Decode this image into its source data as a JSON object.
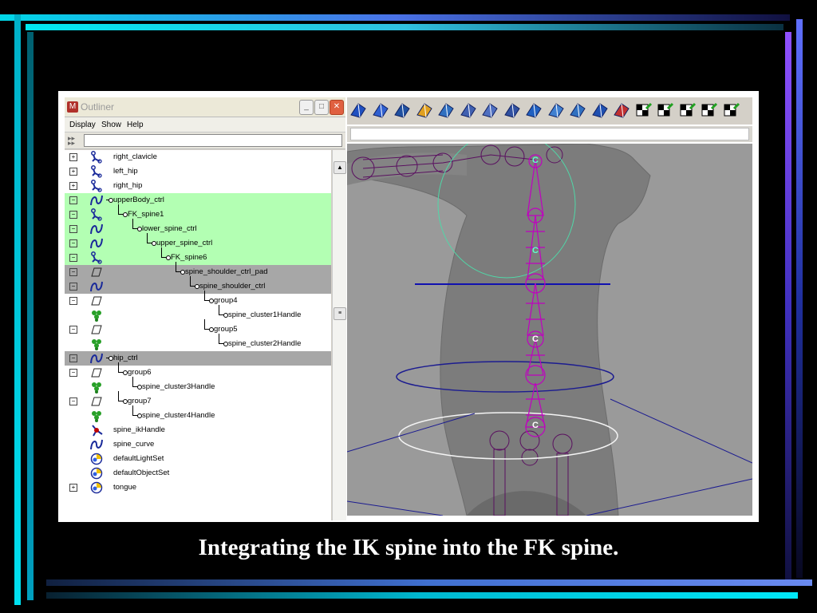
{
  "outliner": {
    "title": "Outliner",
    "menu": [
      "Display",
      "Show",
      "Help"
    ],
    "filter_value": "",
    "items": [
      {
        "label": "right_clavicle",
        "expander": "+",
        "icon": "joint-icon",
        "highlight": ""
      },
      {
        "label": "left_hip",
        "expander": "+",
        "icon": "joint-icon",
        "highlight": ""
      },
      {
        "label": "right_hip",
        "expander": "+",
        "icon": "joint-icon",
        "highlight": ""
      },
      {
        "label": "upperBody_ctrl",
        "expander": "−",
        "icon": "curve-icon",
        "highlight": "green"
      },
      {
        "label": "FK_spine1",
        "expander": "−",
        "icon": "joint-icon",
        "highlight": "green"
      },
      {
        "label": "lower_spine_ctrl",
        "expander": "−",
        "icon": "curve-icon",
        "highlight": "green"
      },
      {
        "label": "upper_spine_ctrl",
        "expander": "−",
        "icon": "curve-icon",
        "highlight": "green"
      },
      {
        "label": "FK_spine6",
        "expander": "−",
        "icon": "joint-icon",
        "highlight": "green"
      },
      {
        "label": "spine_shoulder_ctrl_pad",
        "expander": "−",
        "icon": "transform-icon",
        "highlight": "gray"
      },
      {
        "label": "spine_shoulder_ctrl",
        "expander": "−",
        "icon": "curve-icon",
        "highlight": "gray"
      },
      {
        "label": "group4",
        "expander": "−",
        "icon": "transform-icon",
        "highlight": ""
      },
      {
        "label": "spine_cluster1Handle",
        "expander": "",
        "icon": "cluster-icon",
        "highlight": ""
      },
      {
        "label": "group5",
        "expander": "−",
        "icon": "transform-icon",
        "highlight": ""
      },
      {
        "label": "spine_cluster2Handle",
        "expander": "",
        "icon": "cluster-icon",
        "highlight": ""
      },
      {
        "label": "hip_ctrl",
        "expander": "−",
        "icon": "curve-icon",
        "highlight": "gray"
      },
      {
        "label": "group6",
        "expander": "−",
        "icon": "transform-icon",
        "highlight": ""
      },
      {
        "label": "spine_cluster3Handle",
        "expander": "",
        "icon": "cluster-icon",
        "highlight": ""
      },
      {
        "label": "group7",
        "expander": "−",
        "icon": "transform-icon",
        "highlight": ""
      },
      {
        "label": "spine_cluster4Handle",
        "expander": "",
        "icon": "cluster-icon",
        "highlight": ""
      },
      {
        "label": "spine_ikHandle",
        "expander": "",
        "icon": "ikhandle-icon",
        "highlight": ""
      },
      {
        "label": "spine_curve",
        "expander": "",
        "icon": "curve-icon",
        "highlight": ""
      },
      {
        "label": "defaultLightSet",
        "expander": "",
        "icon": "set-icon",
        "highlight": ""
      },
      {
        "label": "defaultObjectSet",
        "expander": "",
        "icon": "set-icon",
        "highlight": ""
      },
      {
        "label": "tongue",
        "expander": "+",
        "icon": "set-icon",
        "highlight": ""
      }
    ]
  },
  "viewport": {
    "cluster_marker": "C"
  },
  "shelf": {
    "tools": [
      "poly-tool-icon",
      "poly-select-icon",
      "poly-cube-icon",
      "poly-grid-icon",
      "poly-plane-icon",
      "poly-split-icon",
      "poly-extrude-icon",
      "poly-merge-icon",
      "poly-bevel-icon",
      "poly-smooth-icon",
      "poly-wedge-icon",
      "poly-poke-icon",
      "poly-duplicate-icon",
      "uv-checker-icon",
      "uv-map-icon",
      "uv-project-icon",
      "uv-unfold-icon",
      "uv-layout-icon"
    ]
  },
  "caption": "Integrating the IK spine into the FK spine."
}
